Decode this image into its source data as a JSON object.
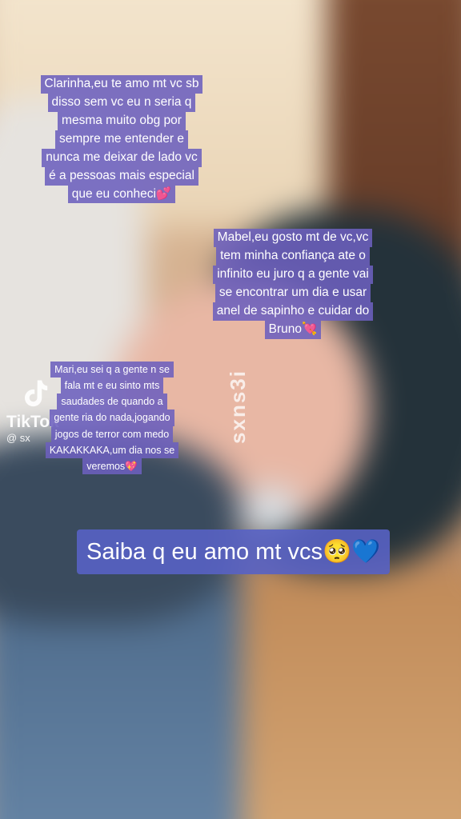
{
  "captions": {
    "clarinha": [
      "Clarinha,eu te amo mt vc sb",
      "disso sem vc eu n seria q",
      "mesma muito obg por",
      "sempre me entender e",
      "nunca me deixar de lado vc",
      "é a pessoas mais especial",
      "que eu conheci💕"
    ],
    "mabel": [
      "Mabel,eu gosto mt de vc,vc",
      "tem minha confiança ate o",
      "infinito eu juro q a gente vai",
      "se encontrar um dia e usar",
      "anel de sapinho e cuidar do",
      "Bruno💘"
    ],
    "mari": [
      "Mari,eu sei q a gente n se",
      "fala mt e eu sinto mts",
      "saudades de quando a",
      "gente ria do nada,jogando",
      "jogos de terror com medo",
      "KAKAKKAKA,um dia nos se",
      "veremos💖"
    ]
  },
  "main_caption": "Saiba q eu amo mt vcs🥺💙",
  "tiktok": {
    "name": "TikTok",
    "handle": "@ sx"
  },
  "watermark": "sxns3i",
  "colors": {
    "caption_bg": "#6c60be",
    "main_caption_bg": "#5862c4",
    "text": "#ffffff"
  }
}
